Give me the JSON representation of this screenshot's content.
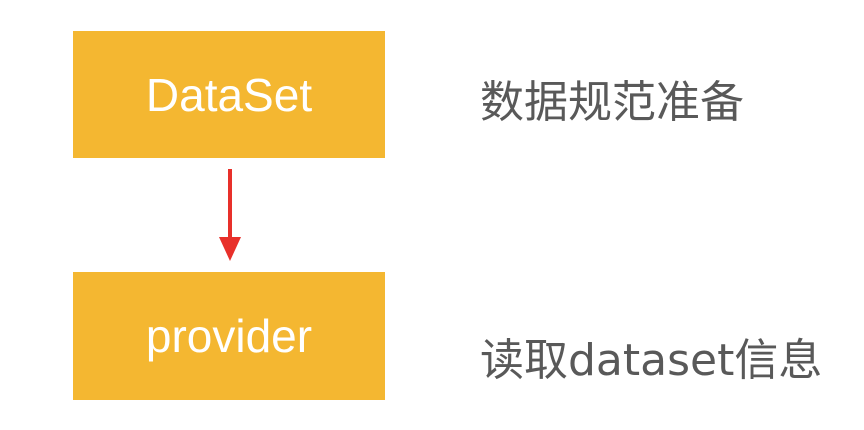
{
  "nodes": [
    {
      "label": "DataSet",
      "description": "数据规范准备"
    },
    {
      "label": "provider",
      "description": "读取dataset信息"
    }
  ],
  "colors": {
    "box_fill": "#f4b731",
    "box_text": "#ffffff",
    "arrow": "#e8302a",
    "description_text": "#595959"
  }
}
